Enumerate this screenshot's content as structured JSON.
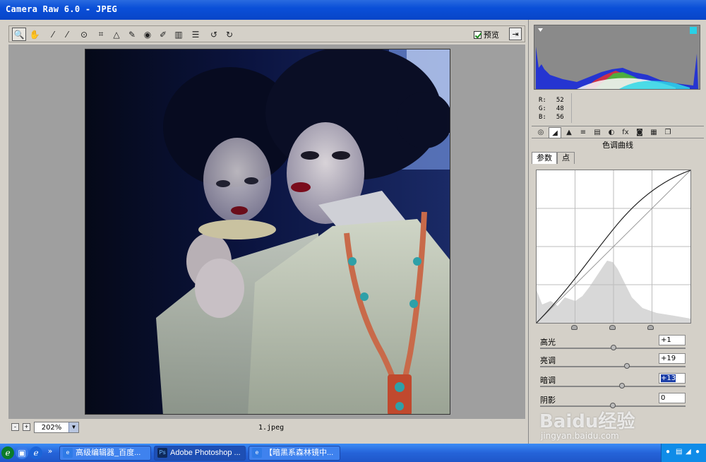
{
  "window": {
    "title": "Camera Raw 6.0 -  JPEG"
  },
  "toolbar": {
    "tools": [
      {
        "name": "zoom-tool-icon",
        "glyph": "🔍"
      },
      {
        "name": "hand-tool-icon",
        "glyph": "✋"
      },
      {
        "name": "white-balance-tool-icon",
        "glyph": "⁄"
      },
      {
        "name": "color-sampler-tool-icon",
        "glyph": "⁄"
      },
      {
        "name": "target-adjustment-tool-icon",
        "glyph": "⊙"
      },
      {
        "name": "crop-tool-icon",
        "glyph": "⌗"
      },
      {
        "name": "straighten-tool-icon",
        "glyph": "△"
      },
      {
        "name": "spot-removal-tool-icon",
        "glyph": "✎"
      },
      {
        "name": "red-eye-tool-icon",
        "glyph": "◉"
      },
      {
        "name": "adjustment-brush-icon",
        "glyph": "✐"
      },
      {
        "name": "graduated-filter-icon",
        "glyph": "▥"
      },
      {
        "name": "preferences-icon",
        "glyph": "☰"
      },
      {
        "name": "rotate-ccw-icon",
        "glyph": "↺"
      },
      {
        "name": "rotate-cw-icon",
        "glyph": "↻"
      }
    ],
    "preview_label": "预览",
    "fullscreen_glyph": "⇥"
  },
  "bottom": {
    "zoom_out": "-",
    "zoom_in": "+",
    "zoom_value": "202%",
    "filename": "1.jpeg"
  },
  "readout": {
    "r_label": "R:",
    "r": "52",
    "g_label": "G:",
    "g": "48",
    "b_label": "B:",
    "b": "56"
  },
  "panel_tabs": [
    "◎",
    "◢",
    "▲",
    "≡",
    "▤",
    "◐",
    "fx",
    "◙",
    "▦",
    "❐"
  ],
  "panel": {
    "section_title": "色调曲线",
    "subtabs": [
      "参数",
      "点"
    ],
    "sliders": [
      {
        "label": "高光",
        "value": "+1",
        "level": 0.505
      },
      {
        "label": "亮调",
        "value": "+19",
        "level": 0.595
      },
      {
        "label": "暗调",
        "value": "+13",
        "level": 0.565
      },
      {
        "label": "阴影",
        "value": "0",
        "level": 0.5
      }
    ]
  },
  "taskbar": {
    "buttons": [
      {
        "label": "高级编辑器_百度...",
        "icon": "e"
      },
      {
        "label": "Adobe Photoshop ...",
        "icon": "Ps"
      },
      {
        "label": "【暗黑系森林镜中...",
        "icon": "e"
      }
    ]
  },
  "watermark": {
    "brand": "Baidu经验",
    "url": "jingyan.baidu.com"
  },
  "colors": {
    "titlebar": "#0845c8",
    "taskbar": "#2563d9",
    "highlight": "#1c3fa7"
  }
}
